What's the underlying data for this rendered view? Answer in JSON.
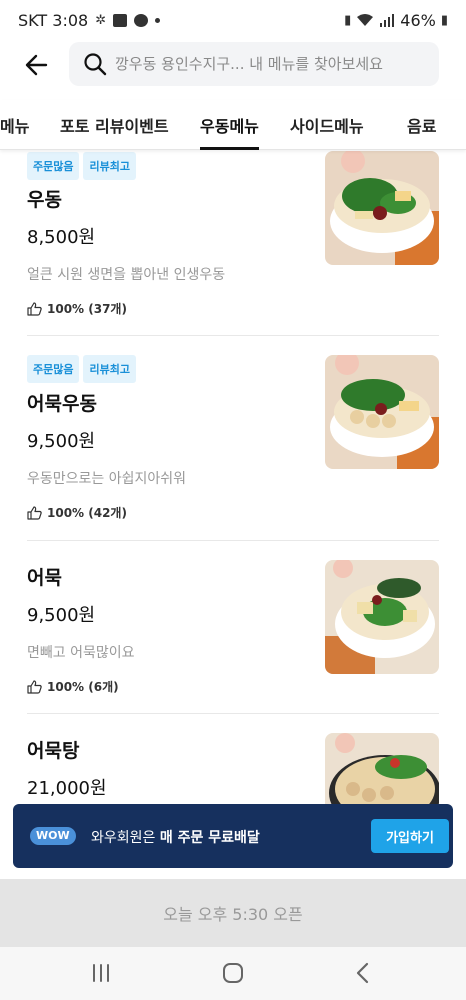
{
  "status_bar": {
    "carrier_time": "SKT 3:08",
    "battery": "46%"
  },
  "header": {
    "search_placeholder": "깡우동 용인수지구... 내 메뉴를 찾아보세요"
  },
  "tabs": [
    {
      "label": "메뉴"
    },
    {
      "label": "포토 리뷰이벤트"
    },
    {
      "label": "우동메뉴"
    },
    {
      "label": "사이드메뉴"
    },
    {
      "label": "음료"
    }
  ],
  "menu_items": [
    {
      "badges": [
        "주문많음",
        "리뷰최고"
      ],
      "name": "우동",
      "price": "8,500원",
      "description": "얼큰 시원 생면을 뽑아낸 인생우동",
      "rating": "100% (37개)"
    },
    {
      "badges": [
        "주문많음",
        "리뷰최고"
      ],
      "name": "어묵우동",
      "price": "9,500원",
      "description": "우동만으로는 아쉽지아쉬워",
      "rating": "100% (42개)"
    },
    {
      "badges": [],
      "name": "어묵",
      "price": "9,500원",
      "description": "면빼고 어묵많이요",
      "rating": "100% (6개)"
    },
    {
      "badges": [],
      "name": "어묵탕",
      "price": "21,000원",
      "description": "",
      "rating": ""
    }
  ],
  "wow_banner": {
    "pill": "WOW",
    "text_prefix": "와우회원은 ",
    "text_bold": "매 주문 무료배달",
    "button": "가입하기"
  },
  "open_bar": {
    "text": "오늘 오후 5:30 오픈"
  },
  "colors": {
    "badge_bg": "#e3f3fc",
    "badge_text": "#1a90d8",
    "banner_bg": "#16305e",
    "join_button": "#1fa3e8"
  }
}
